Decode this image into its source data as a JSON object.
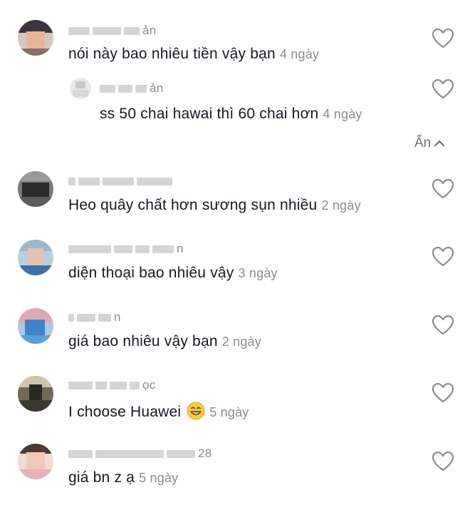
{
  "comments": [
    {
      "username_tail": "ản",
      "text": "nói này bao nhiêu tiền vậy bạn",
      "time": "4 ngày"
    },
    {
      "username_tail": "ản",
      "text": "ss 50 chai hawai thì 60 chai hơn",
      "time": "4 ngày",
      "is_reply": true
    },
    {
      "username_tail": "",
      "text": "Heo quây chất hơn sương sụn nhiều",
      "time": "2 ngày"
    },
    {
      "username_tail": "n",
      "text": "diện thoại bao nhiêu vậy",
      "time": "3 ngày"
    },
    {
      "username_tail": "n",
      "text": "giá bao nhiêu vậy bạn",
      "time": "2 ngày"
    },
    {
      "username_tail": "ọc",
      "text": "I choose Huawei",
      "time": "5 ngày",
      "emoji": "grinning-face"
    },
    {
      "username_tail": "28",
      "text": "giá bn z ạ",
      "time": "5 ngày"
    }
  ],
  "collapse_label": "Ẩn",
  "colors": {
    "text": "#161823",
    "meta": "#8a8b91",
    "background": "#ffffff"
  }
}
